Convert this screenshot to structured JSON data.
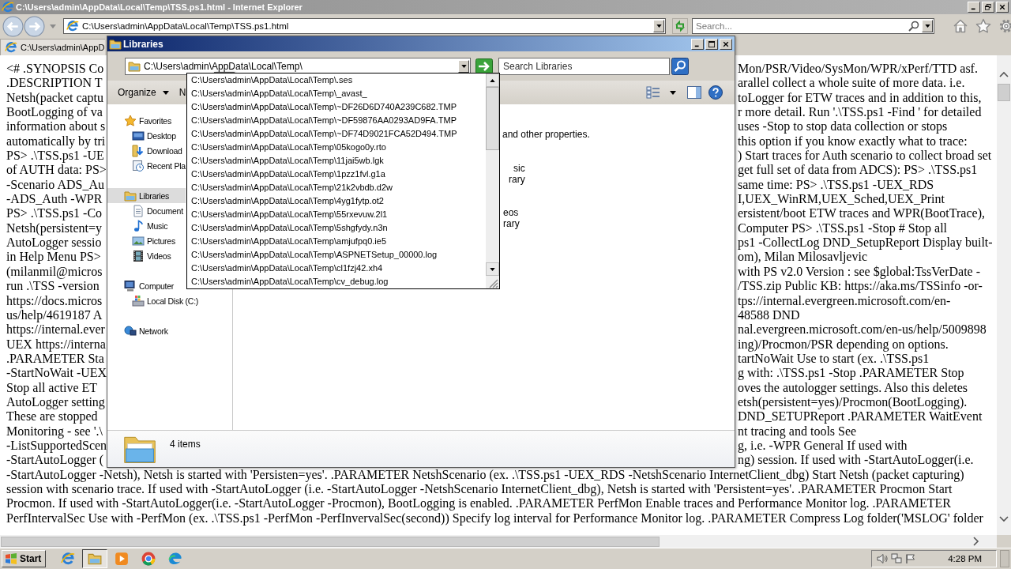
{
  "ie": {
    "title": "C:\\Users\\admin\\AppData\\Local\\Temp\\TSS.ps1.html - Internet Explorer",
    "address": "C:\\Users\\admin\\AppData\\Local\\Temp\\TSS.ps1.html",
    "search": {
      "placeholder": "Search..."
    },
    "tabs": [
      {
        "label": "C:\\Users\\admin\\AppD",
        "selected": true
      }
    ]
  },
  "document": {
    "split_lines": [
      {
        "left": "<# .SYNOPSIS Co",
        "right": "Mon/PSR/Video/SysMon/WPR/xPerf/TTD asf."
      },
      {
        "left": ".DESCRIPTION T",
        "right": "arallel collect a whole suite of more data. i.e."
      },
      {
        "left": "Netsh(packet captu",
        "right": "toLogger for ETW traces and in addition to this,"
      },
      {
        "left": "BootLogging of va",
        "right": "r more detail. Run '.\\TSS.ps1 -Find ' for detailed"
      },
      {
        "left": "information about s",
        "right": "uses -Stop to stop data collection or stops"
      },
      {
        "left": "automatically by tri",
        "right": "this option if you know exactly what to trace:"
      },
      {
        "left": "PS> .\\TSS.ps1 -UE",
        "right": ") Start traces for Auth scenario to collect broad set"
      },
      {
        "left": "of AUTH data: PS>",
        "right": "get full set of data from ADCS): PS> .\\TSS.ps1"
      },
      {
        "left": "-Scenario ADS_Au",
        "right": "same time: PS> .\\TSS.ps1 -UEX_RDS"
      },
      {
        "left": "-ADS_Auth -WPR",
        "right": "I,UEX_WinRM,UEX_Sched,UEX_Print"
      },
      {
        "left": "PS> .\\TSS.ps1 -Co",
        "right": "ersistent/boot ETW traces and WPR(BootTrace),"
      },
      {
        "left": "Netsh(persistent=y",
        "right": "Computer PS> .\\TSS.ps1 -Stop # Stop all"
      },
      {
        "left": "AutoLogger sessio",
        "right": "ps1 -CollectLog DND_SetupReport Display built-"
      },
      {
        "left": "in Help Menu PS>",
        "right": "om), Milan Milosavljevic"
      },
      {
        "left": "(milanmil@micros",
        "right": "with PS v2.0 Version : see $global:TssVerDate -"
      },
      {
        "left": "run .\\TSS -version",
        "right": "/TSS.zip Public KB: https://aka.ms/TSSinfo -or-"
      },
      {
        "left": "https://docs.micros",
        "right": "tps://internal.evergreen.microsoft.com/en-"
      },
      {
        "left": "us/help/4619187 A",
        "right": "48588 DND"
      },
      {
        "left": "https://internal.ever",
        "right": "nal.evergreen.microsoft.com/en-us/help/5009898"
      },
      {
        "left": "UEX https://interna",
        "right": "ing)/Procmon/PSR depending on options."
      },
      {
        "left": ".PARAMETER Sta",
        "right": "tartNoWait Use to start (ex. .\\TSS.ps1"
      },
      {
        "left": "-StartNoWait -UEX",
        "right": "g with: .\\TSS.ps1 -Stop .PARAMETER Stop"
      },
      {
        "left": "Stop all active ET",
        "right": "oves the autologger settings. Also this deletes"
      },
      {
        "left": "AutoLogger setting",
        "right": "etsh(persistent=yes)/Procmon(BootLogging)."
      },
      {
        "left": "These are stopped",
        "right": "DND_SETUPReport .PARAMETER WaitEvent"
      },
      {
        "left": "Monitoring - see '.\\",
        "right": "nt tracing and tools See"
      },
      {
        "left": "-ListSupportedScen",
        "right": "g, i.e. -WPR General If used with"
      },
      {
        "left": "-StartAutoLogger (",
        "right": "ng) session. If used with -StartAutoLogger(i.e."
      }
    ],
    "full_lines": [
      "-StartAutoLogger -Netsh), Netsh is started with 'Persisten=yes'. .PARAMETER NetshScenario (ex. .\\TSS.ps1 -UEX_RDS -NetshScenario InternetClient_dbg) Start Netsh (packet capturing)",
      "session with scenario trace. If used with -StartAutoLogger (i.e. -StartAutoLogger -NetshScenario InternetClient_dbg), Netsh is started with 'Persistent=yes'. .PARAMETER Procmon Start",
      "Procmon. If used with -StartAutoLogger(i.e. -StartAutoLogger -Procmon), BootLogging is enabled. .PARAMETER PerfMon Enable traces and Performance Monitor log. .PARAMETER",
      "PerfIntervalSec Use with -PerfMon (ex. .\\TSS.ps1 -PerfMon -PerfInvervalSec(second)) Specify log interval for Performance Monitor log. .PARAMETER Compress Log folder('MSLOG' folder"
    ]
  },
  "explorer": {
    "title": "Libraries",
    "address": "C:\\Users\\admin\\AppData\\Local\\Temp\\",
    "search": {
      "placeholder": "Search Libraries"
    },
    "toolbar": [
      {
        "label": "Organize",
        "kind": "menu"
      },
      {
        "label": "N",
        "kind": "plain"
      }
    ],
    "nav_tree": [
      {
        "label": "Favorites",
        "kind": "star",
        "selected": false,
        "children": [
          {
            "label": "Desktop",
            "kind": "desktop",
            "selected": false
          },
          {
            "label": "Download",
            "kind": "download",
            "selected": false
          },
          {
            "label": "Recent Pla",
            "kind": "recent",
            "selected": false
          }
        ]
      },
      {
        "label": "Libraries",
        "kind": "library",
        "selected": true,
        "children": [
          {
            "label": "Document",
            "kind": "document",
            "selected": false
          },
          {
            "label": "Music",
            "kind": "music",
            "selected": false
          },
          {
            "label": "Pictures",
            "kind": "picture",
            "selected": false
          },
          {
            "label": "Videos",
            "kind": "video",
            "selected": false
          }
        ]
      },
      {
        "label": "Computer",
        "kind": "computer",
        "selected": false,
        "children": [
          {
            "label": "Local Disk (C:)",
            "kind": "disk",
            "selected": false
          }
        ]
      },
      {
        "label": "Network",
        "kind": "network",
        "selected": false
      }
    ],
    "content": {
      "description": "and other properties.",
      "tiles": [
        {
          "lines": [
            "sic",
            "rary"
          ]
        },
        {
          "lines": [
            "eos",
            "rary"
          ]
        }
      ]
    },
    "autocomplete": [
      "C:\\Users\\admin\\AppData\\Local\\Temp\\.ses",
      "C:\\Users\\admin\\AppData\\Local\\Temp\\_avast_",
      "C:\\Users\\admin\\AppData\\Local\\Temp\\~DF26D6D740A239C682.TMP",
      "C:\\Users\\admin\\AppData\\Local\\Temp\\~DF59876AA0293AD9FA.TMP",
      "C:\\Users\\admin\\AppData\\Local\\Temp\\~DF74D9021FCA52D494.TMP",
      "C:\\Users\\admin\\AppData\\Local\\Temp\\05kogo0y.rto",
      "C:\\Users\\admin\\AppData\\Local\\Temp\\11jai5wb.lgk",
      "C:\\Users\\admin\\AppData\\Local\\Temp\\1pzz1fvl.g1a",
      "C:\\Users\\admin\\AppData\\Local\\Temp\\21k2vbdb.d2w",
      "C:\\Users\\admin\\AppData\\Local\\Temp\\4yg1fytp.ot2",
      "C:\\Users\\admin\\AppData\\Local\\Temp\\55rxevuw.2l1",
      "C:\\Users\\admin\\AppData\\Local\\Temp\\5shgfydy.n3n",
      "C:\\Users\\admin\\AppData\\Local\\Temp\\amjufpq0.ie5",
      "C:\\Users\\admin\\AppData\\Local\\Temp\\ASPNETSetup_00000.log",
      "C:\\Users\\admin\\AppData\\Local\\Temp\\cl1fzj42.xh4",
      "C:\\Users\\admin\\AppData\\Local\\Temp\\cv_debug.log"
    ],
    "status": "4 items"
  },
  "taskbar": {
    "start": "Start",
    "apps": [
      {
        "kind": "e-logo",
        "selected": false
      },
      {
        "kind": "folder",
        "selected": true
      },
      {
        "kind": "play",
        "selected": false
      },
      {
        "kind": "ring-logo",
        "selected": false
      },
      {
        "kind": "wave-logo",
        "selected": false
      }
    ],
    "clock": "4:28 PM"
  }
}
